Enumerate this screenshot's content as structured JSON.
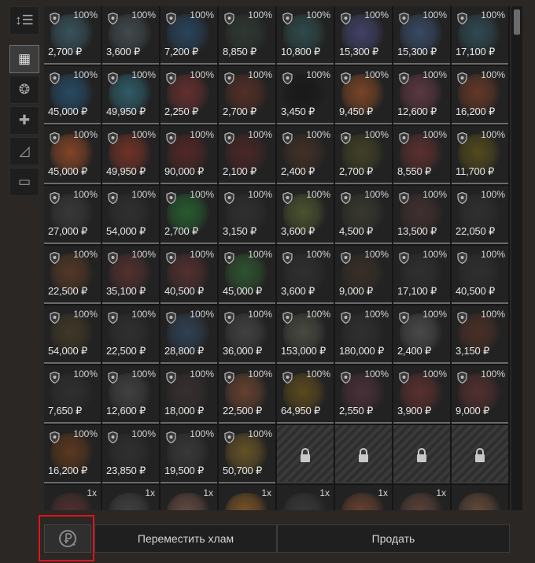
{
  "left_rail": {
    "items": [
      {
        "name": "sort-icon",
        "glyph": "↕☰",
        "active": false
      },
      {
        "name": "grid-view-icon",
        "glyph": "▦",
        "active": true
      },
      {
        "name": "artifacts-icon",
        "glyph": "❂",
        "active": false
      },
      {
        "name": "medkit-icon",
        "glyph": "✚",
        "active": false
      },
      {
        "name": "weapons-icon",
        "glyph": "◿",
        "active": false
      },
      {
        "name": "containers-icon",
        "glyph": "▭",
        "active": false
      }
    ]
  },
  "grid": {
    "cells": [
      {
        "kind": "item",
        "condition": "100%",
        "price": "2,700 ₽",
        "color": "#4a7a8a"
      },
      {
        "kind": "item",
        "condition": "100%",
        "price": "3,600 ₽",
        "color": "#5a6a70"
      },
      {
        "kind": "item",
        "condition": "100%",
        "price": "7,200 ₽",
        "color": "#2e5e8a"
      },
      {
        "kind": "item",
        "condition": "100%",
        "price": "8,850 ₽",
        "color": "#3a4a40"
      },
      {
        "kind": "item",
        "condition": "100%",
        "price": "10,800 ₽",
        "color": "#3a6a6a"
      },
      {
        "kind": "item",
        "condition": "100%",
        "price": "15,300 ₽",
        "color": "#5a5aa0"
      },
      {
        "kind": "item",
        "condition": "100%",
        "price": "15,300 ₽",
        "color": "#4a6a9a"
      },
      {
        "kind": "item",
        "condition": "100%",
        "price": "17,100 ₽",
        "color": "#3a6a7a"
      },
      {
        "kind": "item",
        "condition": "100%",
        "price": "45,000 ₽",
        "color": "#2a6a9a"
      },
      {
        "kind": "item",
        "condition": "100%",
        "price": "49,950 ₽",
        "color": "#3a8aa0"
      },
      {
        "kind": "item",
        "condition": "100%",
        "price": "2,250 ₽",
        "color": "#9a3a3a"
      },
      {
        "kind": "item",
        "condition": "100%",
        "price": "2,700 ₽",
        "color": "#7a3a2a"
      },
      {
        "kind": "item",
        "condition": "100%",
        "price": "3,450 ₽",
        "color": "#111111"
      },
      {
        "kind": "item",
        "condition": "100%",
        "price": "9,450 ₽",
        "color": "#c0602a"
      },
      {
        "kind": "item",
        "condition": "100%",
        "price": "12,600 ₽",
        "color": "#8a4a5a"
      },
      {
        "kind": "item",
        "condition": "100%",
        "price": "16,200 ₽",
        "color": "#9a4a2a"
      },
      {
        "kind": "item",
        "condition": "100%",
        "price": "45,000 ₽",
        "color": "#d0602a"
      },
      {
        "kind": "item",
        "condition": "100%",
        "price": "49,950 ₽",
        "color": "#b0402a"
      },
      {
        "kind": "item",
        "condition": "100%",
        "price": "90,000 ₽",
        "color": "#7a2a2a"
      },
      {
        "kind": "item",
        "condition": "100%",
        "price": "2,100 ₽",
        "color": "#6a2a2a"
      },
      {
        "kind": "item",
        "condition": "100%",
        "price": "2,400 ₽",
        "color": "#5a3a2a"
      },
      {
        "kind": "item",
        "condition": "100%",
        "price": "2,700 ₽",
        "color": "#5a5a2a"
      },
      {
        "kind": "item",
        "condition": "100%",
        "price": "8,550 ₽",
        "color": "#8a3a3a"
      },
      {
        "kind": "item",
        "condition": "100%",
        "price": "11,700 ₽",
        "color": "#7a6a1a"
      },
      {
        "kind": "item",
        "condition": "100%",
        "price": "27,000 ₽",
        "color": "#4a4a4a"
      },
      {
        "kind": "item",
        "condition": "100%",
        "price": "54,000 ₽",
        "color": "#3a3a3a"
      },
      {
        "kind": "item",
        "condition": "100%",
        "price": "2,700 ₽",
        "color": "#2a8a3a"
      },
      {
        "kind": "item",
        "condition": "100%",
        "price": "3,150 ₽",
        "color": "#3a3a3a"
      },
      {
        "kind": "item",
        "condition": "100%",
        "price": "3,600 ₽",
        "color": "#6a7a3a"
      },
      {
        "kind": "item",
        "condition": "100%",
        "price": "4,500 ₽",
        "color": "#4a4a3a"
      },
      {
        "kind": "item",
        "condition": "100%",
        "price": "13,500 ₽",
        "color": "#5a3a3a"
      },
      {
        "kind": "item",
        "condition": "100%",
        "price": "22,050 ₽",
        "color": "#3a3a3a"
      },
      {
        "kind": "item",
        "condition": "100%",
        "price": "22,500 ₽",
        "color": "#7a4a2a"
      },
      {
        "kind": "item",
        "condition": "100%",
        "price": "35,100 ₽",
        "color": "#7a3a3a"
      },
      {
        "kind": "item",
        "condition": "100%",
        "price": "40,500 ₽",
        "color": "#7a3a3a"
      },
      {
        "kind": "item",
        "condition": "100%",
        "price": "45,000 ₽",
        "color": "#3a7a3a"
      },
      {
        "kind": "item",
        "condition": "100%",
        "price": "3,600 ₽",
        "color": "#3a3a3a"
      },
      {
        "kind": "item",
        "condition": "100%",
        "price": "9,000 ₽",
        "color": "#4a3a2a"
      },
      {
        "kind": "item",
        "condition": "100%",
        "price": "17,100 ₽",
        "color": "#3a3a3a"
      },
      {
        "kind": "item",
        "condition": "100%",
        "price": "40,500 ₽",
        "color": "#3a3a3a"
      },
      {
        "kind": "item",
        "condition": "100%",
        "price": "54,000 ₽",
        "color": "#5a4a2a"
      },
      {
        "kind": "item",
        "condition": "100%",
        "price": "22,500 ₽",
        "color": "#3a3a3a"
      },
      {
        "kind": "item",
        "condition": "100%",
        "price": "28,800 ₽",
        "color": "#3a5a7a"
      },
      {
        "kind": "item",
        "condition": "100%",
        "price": "36,000 ₽",
        "color": "#5a5a5a"
      },
      {
        "kind": "item",
        "condition": "100%",
        "price": "153,000 ₽",
        "color": "#6a6a5a"
      },
      {
        "kind": "item",
        "condition": "100%",
        "price": "180,000 ₽",
        "color": "#3a3a3a"
      },
      {
        "kind": "item",
        "condition": "100%",
        "price": "2,400 ₽",
        "color": "#6a6a6a"
      },
      {
        "kind": "item",
        "condition": "100%",
        "price": "3,150 ₽",
        "color": "#6a3a2a"
      },
      {
        "kind": "item",
        "condition": "100%",
        "price": "7,650 ₽",
        "color": "#3a3a3a"
      },
      {
        "kind": "item",
        "condition": "100%",
        "price": "12,600 ₽",
        "color": "#5a5a5a"
      },
      {
        "kind": "item",
        "condition": "100%",
        "price": "18,000 ₽",
        "color": "#4a3a3a"
      },
      {
        "kind": "item",
        "condition": "100%",
        "price": "22,500 ₽",
        "color": "#9a5a3a"
      },
      {
        "kind": "item",
        "condition": "100%",
        "price": "64,950 ₽",
        "color": "#8a6a1a"
      },
      {
        "kind": "item",
        "condition": "100%",
        "price": "2,550 ₽",
        "color": "#6a3a4a"
      },
      {
        "kind": "item",
        "condition": "100%",
        "price": "3,900 ₽",
        "color": "#8a3a3a"
      },
      {
        "kind": "item",
        "condition": "100%",
        "price": "9,000 ₽",
        "color": "#7a3a3a"
      },
      {
        "kind": "item",
        "condition": "100%",
        "price": "16,200 ₽",
        "color": "#8a4a1a"
      },
      {
        "kind": "item",
        "condition": "100%",
        "price": "23,850 ₽",
        "color": "#3a3a3a"
      },
      {
        "kind": "item",
        "condition": "100%",
        "price": "19,500 ₽",
        "color": "#4a4a4a"
      },
      {
        "kind": "item",
        "condition": "100%",
        "price": "50,700 ₽",
        "color": "#9a7a2a"
      },
      {
        "kind": "locked"
      },
      {
        "kind": "locked"
      },
      {
        "kind": "locked"
      },
      {
        "kind": "locked"
      },
      {
        "kind": "stack",
        "qty": "1x",
        "color": "#7a3a3a"
      },
      {
        "kind": "stack",
        "qty": "1x",
        "color": "#5a5a5a"
      },
      {
        "kind": "stack",
        "qty": "1x",
        "color": "#9a6a5a"
      },
      {
        "kind": "stack",
        "qty": "1x",
        "color": "#c07a2a"
      },
      {
        "kind": "stack",
        "qty": "1x",
        "color": "#4a4a4a"
      },
      {
        "kind": "stack",
        "qty": "1x",
        "color": "#a05a3a"
      },
      {
        "kind": "stack",
        "qty": "1x",
        "color": "#8a5a4a"
      },
      {
        "kind": "stack",
        "qty": "",
        "color": "#9a6a4a"
      }
    ]
  },
  "bottom_bar": {
    "move_junk_label": "Переместить хлам",
    "sell_label": "Продать",
    "auto_sell_icon": "ruble-cycle-icon"
  },
  "colors": {
    "highlight": "#e0141a",
    "background": "#2a2724"
  }
}
